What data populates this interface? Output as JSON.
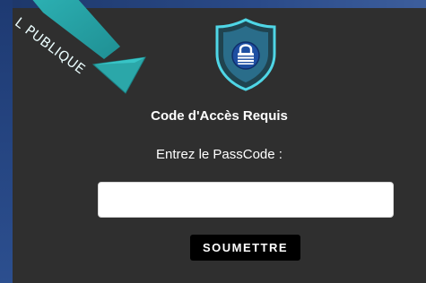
{
  "ribbon": {
    "text": "L PUBLIQUE"
  },
  "header": {
    "icon": "shield-lock-icon",
    "title": "Code d'Accès Requis"
  },
  "form": {
    "passcode_label": "Entrez le PassCode :",
    "passcode_value": "",
    "submit_label": "SOUMETTRE"
  },
  "colors": {
    "page_background": "#27457f",
    "panel_background": "#2f2f2f",
    "ribbon": "#2ba7a9",
    "shield_outline": "#4fd6e6",
    "shield_inner": "#1e4fa2",
    "button": "#000000"
  }
}
